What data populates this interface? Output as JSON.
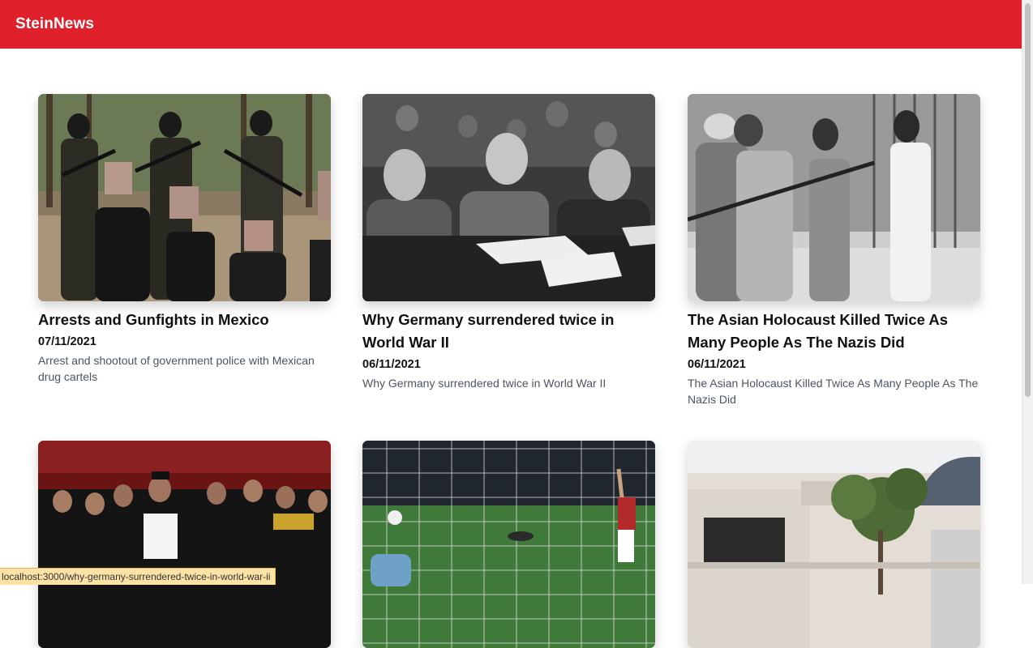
{
  "header": {
    "brand": "SteinNews",
    "bg_color": "#e0202b"
  },
  "articles": [
    {
      "title": "Arrests and Gunfights in Mexico",
      "date": "07/11/2021",
      "description": "Arrest and shootout of government police with Mexican drug cartels",
      "image": "photo-armed-men-arrest"
    },
    {
      "title": "Why Germany surrendered twice in World War II",
      "date": "06/11/2021",
      "description": "Why Germany surrendered twice in World War II",
      "image": "photo-surrender-signing"
    },
    {
      "title": "The Asian Holocaust Killed Twice As Many People As The Nazis Did",
      "date": "06/11/2021",
      "description": "The Asian Holocaust Killed Twice As Many People As The Nazis Did",
      "image": "photo-soldiers-bayonet"
    },
    {
      "title": "",
      "date": "",
      "description": "",
      "image": "photo-official-speech"
    },
    {
      "title": "",
      "date": "",
      "description": "",
      "image": "photo-football-goal"
    },
    {
      "title": "",
      "date": "",
      "description": "",
      "image": "photo-white-house-tree"
    }
  ],
  "status_bar": {
    "url": "localhost:3000/why-germany-surrendered-twice-in-world-war-ii"
  }
}
